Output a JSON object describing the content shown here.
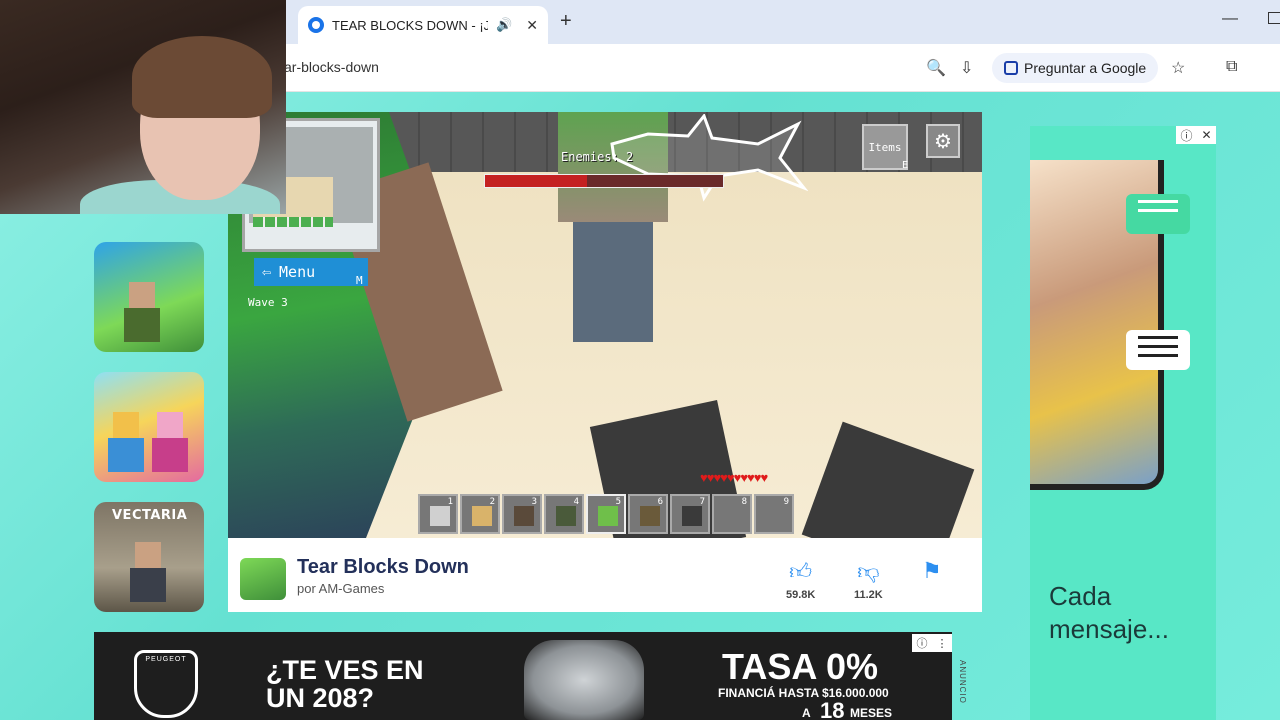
{
  "browser": {
    "tab_title": "TEAR BLOCKS DOWN - ¡Jue",
    "tab_sound_icon": "speaker-icon",
    "url_fragment": "ar-blocks-down",
    "ask_google_label": "Preguntar a Google"
  },
  "game_ui": {
    "menu_label": "Menu",
    "menu_key": "M",
    "wave_text": "Wave 3",
    "enemies_text": "Enemies: 2",
    "enemy_health_fraction": 0.43,
    "items_label": "Items",
    "items_key": "E",
    "hearts": "♥♥♥♥♥♥♥♥♥♥",
    "hotbar": [
      {
        "num": "1",
        "item_color": "#d0d0d0"
      },
      {
        "num": "2",
        "item_color": "#d9b36a"
      },
      {
        "num": "3",
        "item_color": "#5a4a3a"
      },
      {
        "num": "4",
        "item_color": "#4a5a3a"
      },
      {
        "num": "5",
        "item_color": "#6fbf4a"
      },
      {
        "num": "6",
        "item_color": "#6a5a3a"
      },
      {
        "num": "7",
        "item_color": "#3a3a3a"
      },
      {
        "num": "8",
        "item_color": ""
      },
      {
        "num": "9",
        "item_color": ""
      }
    ]
  },
  "game_info": {
    "title": "Tear Blocks Down",
    "author": "por AM-Games",
    "likes": "59.8K",
    "dislikes": "11.2K"
  },
  "sidebar": {
    "third_game_label": "VECTARIA"
  },
  "ad_right": {
    "text": "Cada mensaje..."
  },
  "ad_bottom": {
    "brand": "PEUGEOT",
    "question": "¿TE VES EN UN 208?",
    "rate": "TASA 0%",
    "finance": "FINANCIÁ HASTA $16.000.000",
    "term_prefix": "A",
    "term_number": "18",
    "term_suffix": "MESES",
    "vertical_label": "ANUNCIO"
  },
  "colors": {
    "accent_blue": "#2d8ff0",
    "page_teal": "#6fe8d8",
    "title_navy": "#23305a"
  }
}
